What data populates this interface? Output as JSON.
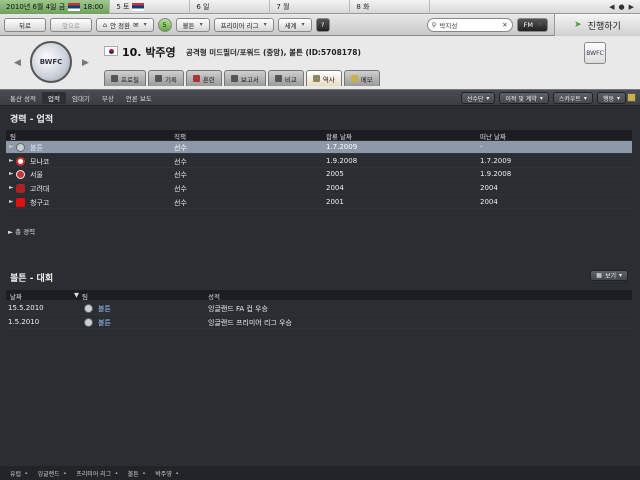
{
  "calendar": {
    "today_date": "2010년 6월 4일 금",
    "today_time": "18:00",
    "days": [
      {
        "label": "5 토"
      },
      {
        "label": "6 일"
      },
      {
        "label": "7 월"
      },
      {
        "label": "8 화"
      }
    ]
  },
  "toolbar": {
    "back": "뒤로",
    "forward": "앞으로",
    "home": "안 정환",
    "club": "볼튼",
    "league": "프리미어 리그",
    "world": "세계",
    "help": "?",
    "search_value": "박지성",
    "fm": "FM",
    "proceed": "진행하기"
  },
  "player": {
    "number_name": "10. 박주영",
    "info": "공격형 미드필더/포워드 (중앙), 볼튼 (ID:5708178)"
  },
  "tabs": [
    {
      "label": "프로필"
    },
    {
      "label": "기록"
    },
    {
      "label": "훈련"
    },
    {
      "label": "보고서"
    },
    {
      "label": "비교"
    },
    {
      "label": "역사"
    },
    {
      "label": "메모"
    }
  ],
  "subnav": {
    "items": [
      "통산 성적",
      "업적",
      "임대기",
      "부상",
      "언론 보도"
    ],
    "right_buttons": [
      "선수단",
      "이적 및 계약",
      "스카우트",
      "행동"
    ]
  },
  "career": {
    "title": "경력 - 업적",
    "headers": [
      "팀",
      "직책",
      "합류 날짜",
      "떠난 날짜"
    ],
    "rows": [
      {
        "team": "볼튼",
        "role": "선수",
        "joined": "1.7.2009",
        "left": "-"
      },
      {
        "team": "모나코",
        "role": "선수",
        "joined": "1.9.2008",
        "left": "1.7.2009"
      },
      {
        "team": "서울",
        "role": "선수",
        "joined": "2005",
        "left": "1.9.2008"
      },
      {
        "team": "고려대",
        "role": "선수",
        "joined": "2004",
        "left": "2004"
      },
      {
        "team": "청구고",
        "role": "선수",
        "joined": "2001",
        "left": "2004"
      }
    ],
    "total_label": "총 경력"
  },
  "competitions": {
    "title": "볼튼 - 대회",
    "view_button": "보기",
    "headers": [
      "날짜",
      "팀",
      "성적"
    ],
    "rows": [
      {
        "date": "15.5.2010",
        "team": "볼튼",
        "result": "잉글랜드 FA 컵 우승"
      },
      {
        "date": "1.5.2010",
        "team": "볼튼",
        "result": "잉글랜드 프리미어 리그 우승"
      }
    ]
  },
  "bottombar": [
    "유럽",
    "잉글랜드",
    "프리미어 리그",
    "볼튼",
    "박주영"
  ],
  "colors": {
    "selected_row": "#8d99a8",
    "link": "#9cc3ff",
    "background": "#2a2d31"
  }
}
